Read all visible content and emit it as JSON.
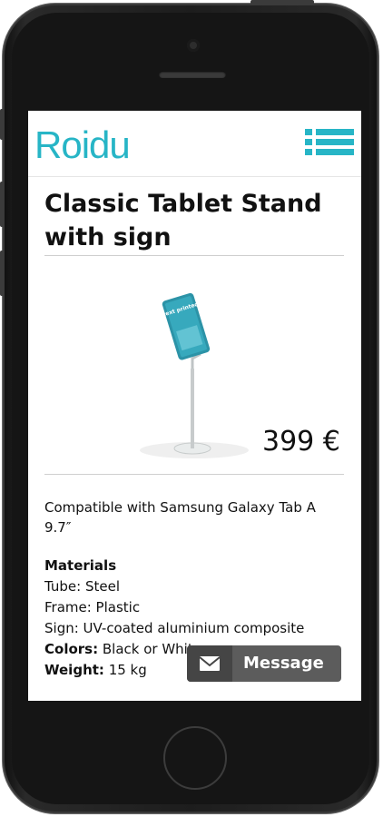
{
  "header": {
    "logo_text": "Roidu",
    "menu_icon": "hamburger-menu-icon",
    "brand_color": "#27b5c6"
  },
  "product": {
    "title": "Classic Tablet Stand with sign",
    "price": "399 €",
    "image_sign_text": "Your text printed here",
    "description": "Compatible with Samsung Galaxy Tab A 9.7″"
  },
  "specs": {
    "materials_heading": "Materials",
    "tube": "Tube: Steel",
    "frame": "Frame: Plastic",
    "sign": "Sign: UV-coated aluminium composite",
    "colors_label": "Colors:",
    "colors_value": " Black or White",
    "weight_label": "Weight:",
    "weight_value": " 15 kg"
  },
  "message_button": {
    "label": "Message",
    "icon": "envelope-icon"
  }
}
